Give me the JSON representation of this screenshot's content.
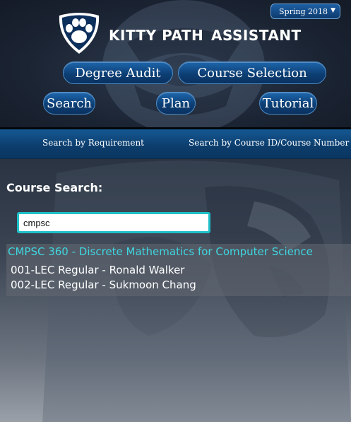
{
  "header": {
    "term": "Spring 2018",
    "brand_left": "KITTY PATH",
    "brand_right": "ASSISTANT",
    "nav": {
      "degree_audit": "Degree Audit",
      "course_selection": "Course Selection",
      "search": "Search",
      "plan": "Plan",
      "tutorial": "Tutorial"
    }
  },
  "subnav": {
    "by_requirement": "Search by Requirement",
    "by_course_id": "Search by Course ID/Course Number"
  },
  "search": {
    "title": "Course Search:",
    "query": "cmpsc"
  },
  "results": [
    {
      "course": "CMPSC 360 - Discrete Mathematics for Computer Science",
      "sections": [
        "001-LEC Regular - Ronald Walker",
        "002-LEC Regular - Sukmoon Chang"
      ]
    }
  ],
  "icons": {
    "logo": "paw-shield-icon",
    "term_dropdown": "caret-down-icon"
  },
  "colors": {
    "accent": "#3fd6df",
    "button": "#0d3f75",
    "input_border": "#1fc0c7"
  }
}
